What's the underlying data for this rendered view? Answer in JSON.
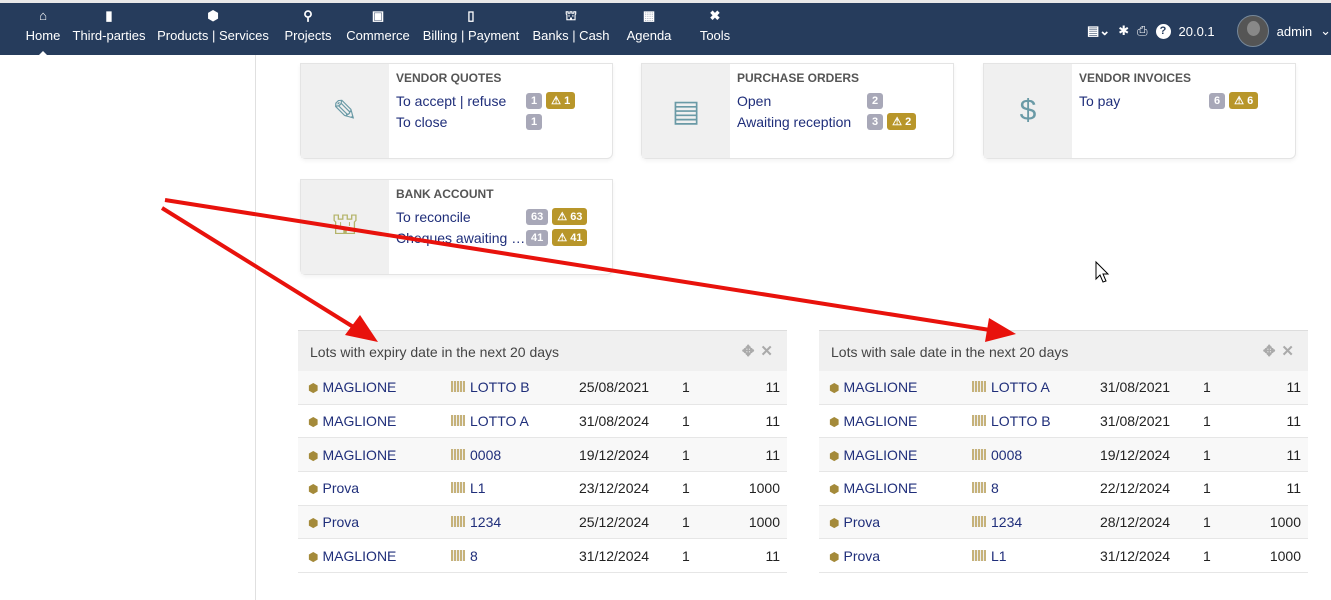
{
  "nav": {
    "items": [
      {
        "label": "Home",
        "icon": "home-icon",
        "glyph": "⌂"
      },
      {
        "label": "Third-parties",
        "icon": "building-icon",
        "glyph": "▮"
      },
      {
        "label": "Products | Services",
        "icon": "cube-icon",
        "glyph": "⬢"
      },
      {
        "label": "Projects",
        "icon": "sitemap-icon",
        "glyph": "⚲"
      },
      {
        "label": "Commerce",
        "icon": "briefcase-icon",
        "glyph": "▣"
      },
      {
        "label": "Billing | Payment",
        "icon": "invoice-icon",
        "glyph": "▯"
      },
      {
        "label": "Banks | Cash",
        "icon": "bank-icon",
        "glyph": "⛫"
      },
      {
        "label": "Agenda",
        "icon": "calendar-icon",
        "glyph": "▦"
      },
      {
        "label": "Tools",
        "icon": "tools-icon",
        "glyph": "✖"
      }
    ],
    "version": "20.0.1",
    "user": "admin"
  },
  "cards": [
    {
      "title": "VENDOR QUOTES",
      "lines": [
        {
          "label": "To accept | refuse",
          "count": "1",
          "late": "1"
        },
        {
          "label": "To close",
          "count": "1"
        }
      ]
    },
    {
      "title": "PURCHASE ORDERS",
      "lines": [
        {
          "label": "Open",
          "count": "2"
        },
        {
          "label": "Awaiting reception",
          "count": "3",
          "late": "2"
        }
      ]
    },
    {
      "title": "VENDOR INVOICES",
      "lines": [
        {
          "label": "To pay",
          "count": "6",
          "late": "6"
        }
      ]
    },
    {
      "title": "BANK ACCOUNT",
      "lines": [
        {
          "label": "To reconcile",
          "count": "63",
          "late": "63"
        },
        {
          "label": "Cheques awaiting deposit",
          "count": "41",
          "late": "41"
        }
      ]
    }
  ],
  "panels": [
    {
      "title": "Lots with expiry date in the next 20 days",
      "rows": [
        [
          "MAGLIONE",
          "LOTTO B",
          "25/08/2021",
          "1",
          "11"
        ],
        [
          "MAGLIONE",
          "LOTTO A",
          "31/08/2024",
          "1",
          "11"
        ],
        [
          "MAGLIONE",
          "0008",
          "19/12/2024",
          "1",
          "11"
        ],
        [
          "Prova",
          "L1",
          "23/12/2024",
          "1",
          "1000"
        ],
        [
          "Prova",
          "1234",
          "25/12/2024",
          "1",
          "1000"
        ],
        [
          "MAGLIONE",
          "8",
          "31/12/2024",
          "1",
          "11"
        ]
      ]
    },
    {
      "title": "Lots with sale date in the next 20 days",
      "rows": [
        [
          "MAGLIONE",
          "LOTTO A",
          "31/08/2021",
          "1",
          "11"
        ],
        [
          "MAGLIONE",
          "LOTTO B",
          "31/08/2021",
          "1",
          "11"
        ],
        [
          "MAGLIONE",
          "0008",
          "19/12/2024",
          "1",
          "11"
        ],
        [
          "MAGLIONE",
          "8",
          "22/12/2024",
          "1",
          "11"
        ],
        [
          "Prova",
          "1234",
          "28/12/2024",
          "1",
          "1000"
        ],
        [
          "Prova",
          "L1",
          "31/12/2024",
          "1",
          "1000"
        ]
      ]
    }
  ]
}
